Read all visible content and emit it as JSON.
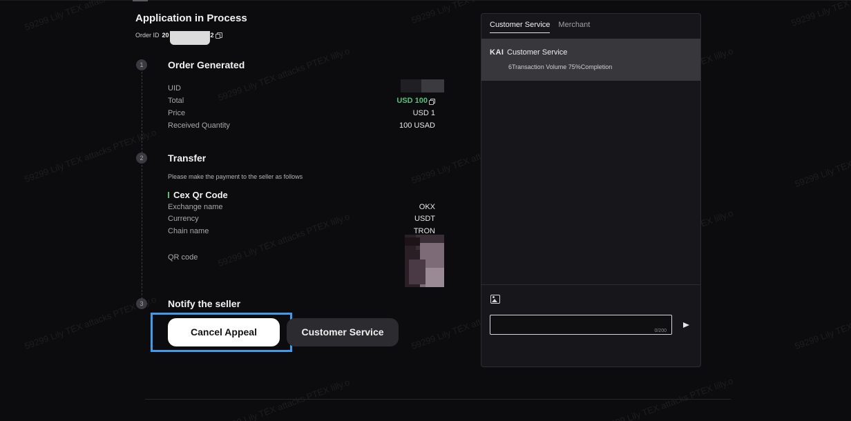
{
  "header": {
    "title": "Application in Process",
    "order_id_label": "Order ID",
    "order_id_visible_start": "20",
    "order_id_visible_end": "2"
  },
  "steps": [
    {
      "number": "1",
      "title": "Order Generated"
    },
    {
      "number": "2",
      "title": "Transfer"
    },
    {
      "number": "3",
      "title": "Notify the seller"
    }
  ],
  "order": {
    "uid_label": "UID",
    "total_label": "Total",
    "total_value": "USD 100",
    "price_label": "Price",
    "price_value": "USD 1",
    "received_label": "Received Quantity",
    "received_value": "100 USAD"
  },
  "transfer": {
    "note": "Please make the payment to the seller as follows",
    "method_title": "Cex Qr Code",
    "exchange_label": "Exchange name",
    "exchange_value": "OKX",
    "currency_label": "Currency",
    "currency_value": "USDT",
    "chain_label": "Chain name",
    "chain_value": "TRON",
    "qr_label": "QR code"
  },
  "actions": {
    "cancel_label": "Cancel Appeal",
    "cs_label": "Customer Service"
  },
  "chat": {
    "tabs": [
      {
        "label": "Customer Service",
        "active": true
      },
      {
        "label": "Merchant",
        "active": false
      }
    ],
    "agent_logo": "KAI",
    "agent_name": "Customer Service",
    "agent_stats": "6Transaction Volume  75%Completion",
    "char_count": "0/200"
  },
  "watermark": "59299 Lily TEX attacks PTEX lilly.o",
  "colors": {
    "accent_green": "#4fc37b",
    "highlight_blue": "#3b9cf0",
    "background": "#0c0c0e",
    "panel": "#17171b"
  },
  "icons": [
    "copy-icon",
    "image-icon",
    "send-icon"
  ]
}
